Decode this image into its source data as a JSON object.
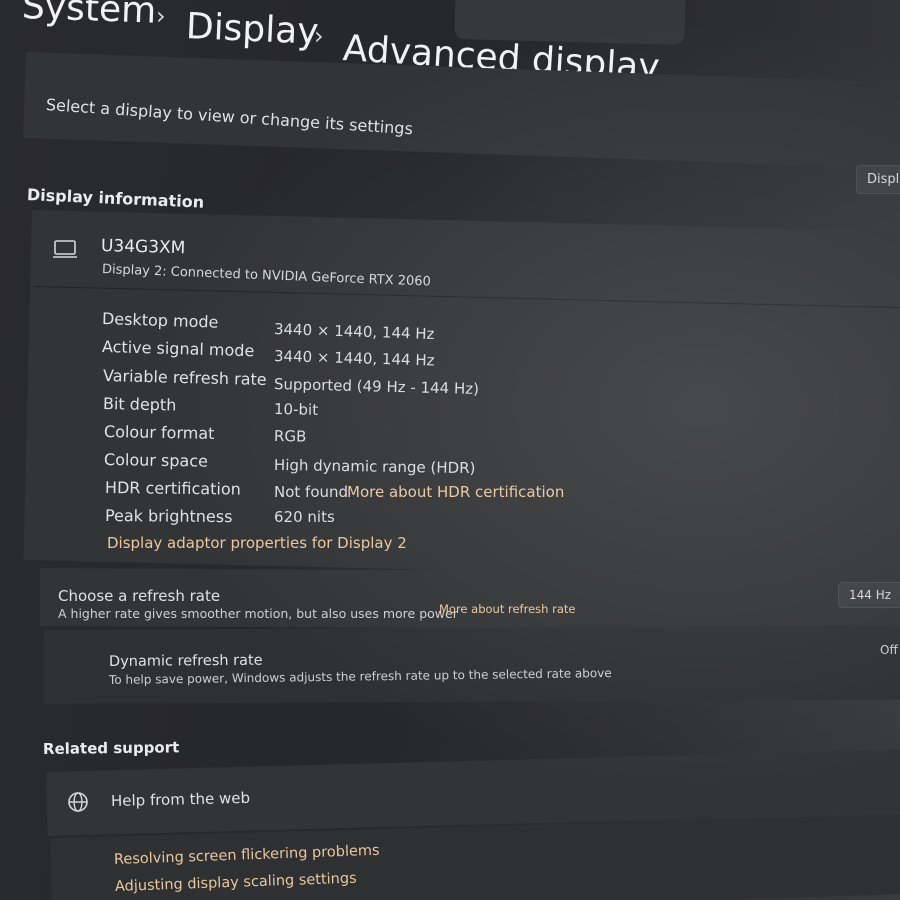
{
  "breadcrumb": {
    "root": "System",
    "middle": "Display",
    "current": "Advanced display",
    "separator": "›"
  },
  "select_display": {
    "label": "Select a display to view or change its settings",
    "button_label": "Display"
  },
  "display_info": {
    "section_title": "Display information",
    "monitor_name": "U34G3XM",
    "connection": "Display 2: Connected to NVIDIA GeForce RTX 2060",
    "icon": "laptop-icon",
    "rows": [
      {
        "label": "Desktop mode",
        "value": "3440 × 1440, 144 Hz"
      },
      {
        "label": "Active signal mode",
        "value": "3440 × 1440, 144 Hz"
      },
      {
        "label": "Variable refresh rate",
        "value": "Supported (49 Hz - 144 Hz)"
      },
      {
        "label": "Bit depth",
        "value": "10-bit"
      },
      {
        "label": "Colour format",
        "value": "RGB"
      },
      {
        "label": "Colour space",
        "value": "High dynamic range (HDR)"
      },
      {
        "label": "HDR certification",
        "value": "Not found",
        "link": "More about HDR certification"
      },
      {
        "label": "Peak brightness",
        "value": "620 nits"
      }
    ],
    "adapter_link": "Display adaptor properties for Display 2"
  },
  "refresh": {
    "title": "Choose a refresh rate",
    "description": "A higher rate gives smoother motion, but also uses more power",
    "link": "More about refresh rate",
    "selected": "144 Hz"
  },
  "dynamic_refresh": {
    "title": "Dynamic refresh rate",
    "description": "To help save power, Windows adjusts the refresh rate up to the selected rate above",
    "state": "Off"
  },
  "related_support": {
    "section_title": "Related support",
    "help_title": "Help from the web",
    "help_icon": "globe-icon",
    "links": [
      "Resolving screen flickering problems",
      "Adjusting display scaling settings"
    ]
  },
  "colors": {
    "background": "#2a2b2d",
    "card": "#333436",
    "link": "#e9c79f",
    "text": "#e6e6e6"
  }
}
